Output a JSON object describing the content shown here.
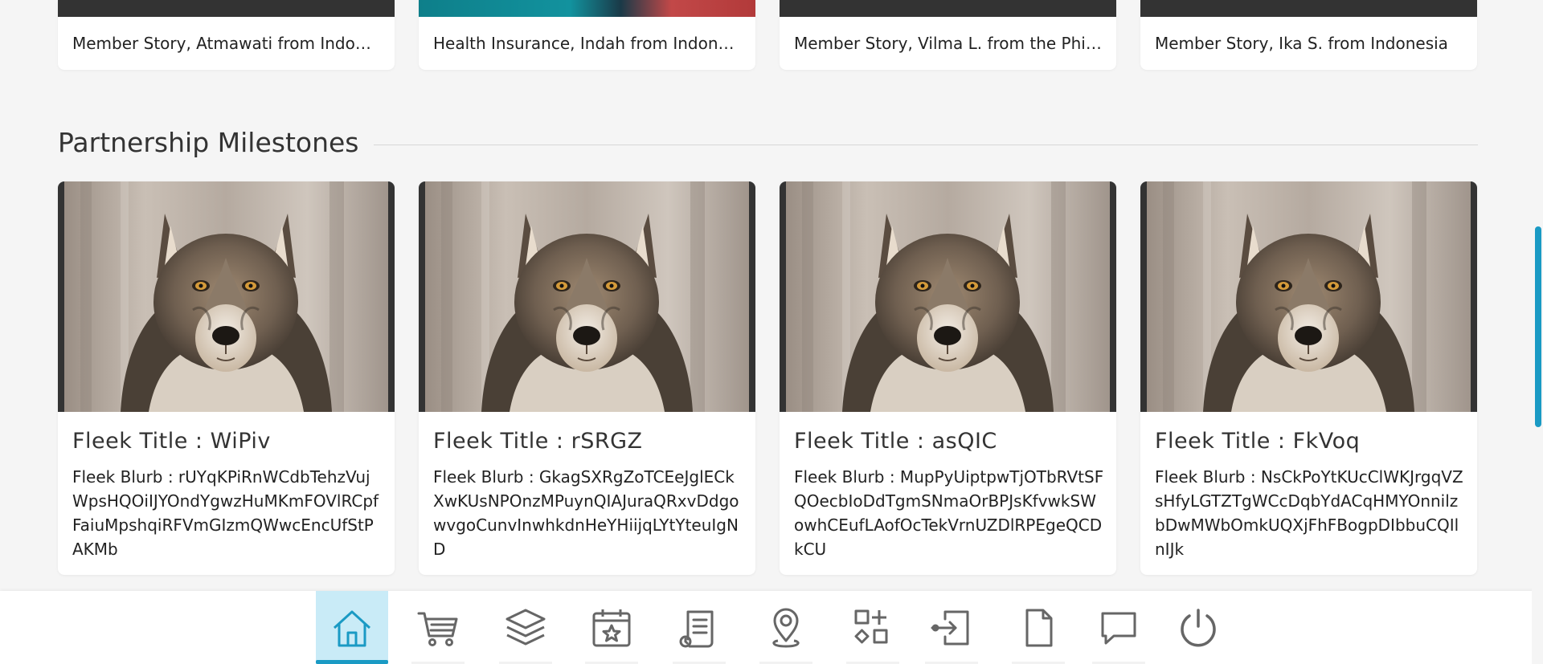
{
  "top_stories": [
    {
      "caption": "Member Story, Atmawati from Indonesia"
    },
    {
      "caption": "Health Insurance, Indah from Indonesia"
    },
    {
      "caption": "Member Story, Vilma L. from the Philippines"
    },
    {
      "caption": "Member Story, Ika S. from Indonesia"
    }
  ],
  "section": {
    "title": "Partnership Milestones"
  },
  "cards": [
    {
      "title": "Fleek Title : WiPiv",
      "blurb": "Fleek Blurb : rUYqKPiRnWCdbTehzVujWpsHQOiIJYOndYgwzHuMKmFOVlRCpfFaiuMpshqiRFVmGIzmQWwcEncUfStPAKMb",
      "image": "wolf-photo"
    },
    {
      "title": "Fleek Title : rSRGZ",
      "blurb": "Fleek Blurb : GkagSXRgZoTCEeJglECkXwKUsNPOnzMPuynQIAJuraQRxvDdgowvgoCunvInwhkdnHeYHiijqLYtYteuIgND",
      "image": "wolf-photo"
    },
    {
      "title": "Fleek Title : asQIC",
      "blurb": "Fleek Blurb : MupPyUiptpwTjOTbRVtSFQOecbIoDdTgmSNmaOrBPJsKfvwkSWowhCEufLAofOcTekVrnUZDlRPEgeQCDkCU",
      "image": "wolf-photo"
    },
    {
      "title": "Fleek Title : FkVoq",
      "blurb": "Fleek Blurb : NsCkPoYtKUcClWKJrgqVZsHfyLGTZTgWCcDqbYdACqHMYOnnilzbDwMWbOmkUQXjFhFBogpDIbbuCQIlnIJk",
      "image": "wolf-photo"
    }
  ],
  "bottom_nav": [
    {
      "icon": "home-icon",
      "active": true
    },
    {
      "icon": "cart-icon",
      "active": false
    },
    {
      "icon": "layers-icon",
      "active": false
    },
    {
      "icon": "calendar-star-icon",
      "active": false
    },
    {
      "icon": "document-list-icon",
      "active": false
    },
    {
      "icon": "location-pin-icon",
      "active": false
    },
    {
      "icon": "widgets-icon",
      "active": false
    },
    {
      "icon": "login-icon",
      "active": false
    },
    {
      "icon": "file-icon",
      "active": false
    },
    {
      "icon": "chat-icon",
      "active": false
    },
    {
      "icon": "power-icon",
      "active": false
    }
  ],
  "colors": {
    "accent": "#1a9ac4",
    "active_bg": "#c9ebf7",
    "icon": "#666666"
  }
}
